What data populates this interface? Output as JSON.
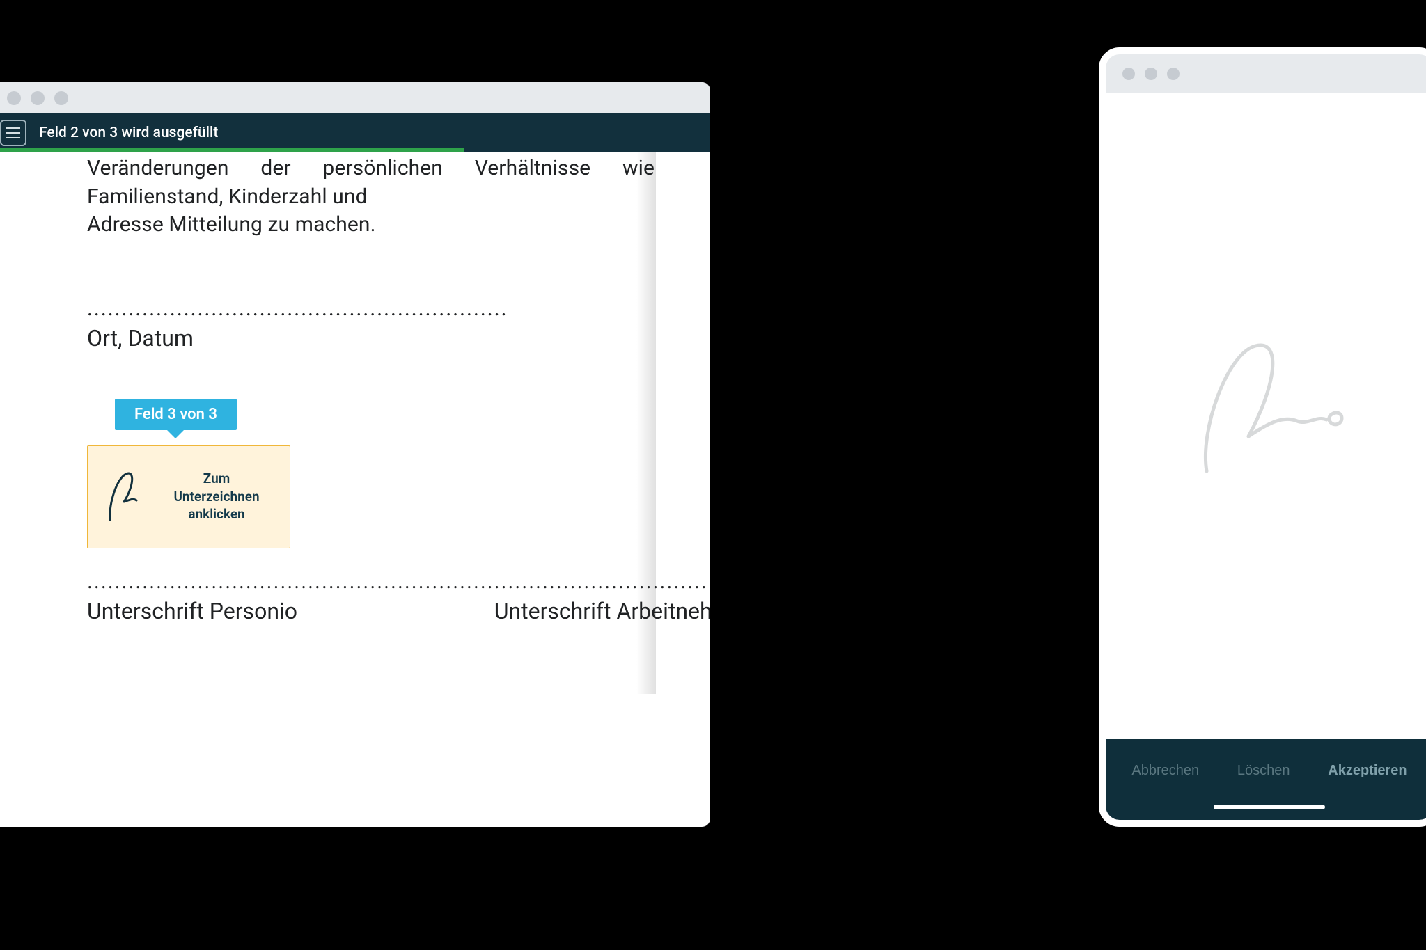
{
  "desktop": {
    "toolbar": {
      "progress_text": "Feld 2 von 3 wird ausgefüllt",
      "progress_pct": 69
    },
    "doc": {
      "body_line1": "Veränderungen der persönlichen Verhältnisse wie Familienstand, Kinderzahl und",
      "body_line2": "Adresse Mitteilung zu machen.",
      "dotted_placeholder": ".............................................................",
      "place_date_label": "Ort, Datum",
      "field_bubble": "Feld 3 von 3",
      "sign_card_label": "Zum Unterzeichnen anklicken",
      "sig_dots_left": "...........................................................",
      "sig_dots_right": ".......................................................................................",
      "sig_caption_left": "Unterschrift Personio",
      "sig_caption_right": "Unterschrift Arbeitnehmer/-in"
    }
  },
  "mobile": {
    "actions": {
      "cancel": "Abbrechen",
      "clear": "Löschen",
      "accept": "Akzeptieren"
    }
  }
}
